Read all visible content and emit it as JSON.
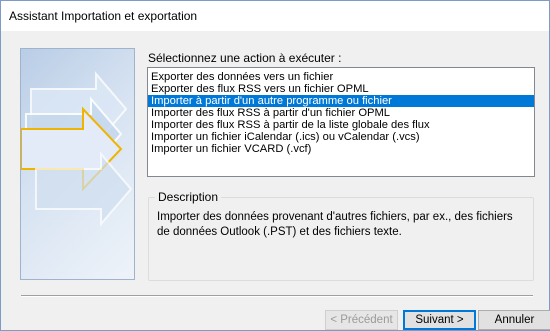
{
  "window": {
    "title": "Assistant Importation et exportation"
  },
  "prompt": "Sélectionnez une action à exécuter :",
  "actions": [
    "Exporter des données vers un fichier",
    "Exporter des flux RSS vers un fichier OPML",
    "Importer à partir d'un autre programme ou fichier",
    "Importer des flux RSS à partir d'un fichier OPML",
    "Importer des flux RSS à partir de la liste globale des flux",
    "Importer un fichier iCalendar (.ics) ou vCalendar (.vcs)",
    "Importer un fichier VCARD (.vcf)"
  ],
  "selected_action": "Importer à partir d'un autre programme ou fichier",
  "description": {
    "legend": "Description",
    "text": "Importer des données provenant d'autres fichiers, par ex., des fichiers de données Outlook (.PST) et des fichiers texte."
  },
  "buttons": {
    "prev": "< Précédent",
    "next": "Suivant >",
    "cancel": "Annuler"
  },
  "colors": {
    "selection": "#0078d7",
    "arrow_accent": "#f0b400"
  }
}
